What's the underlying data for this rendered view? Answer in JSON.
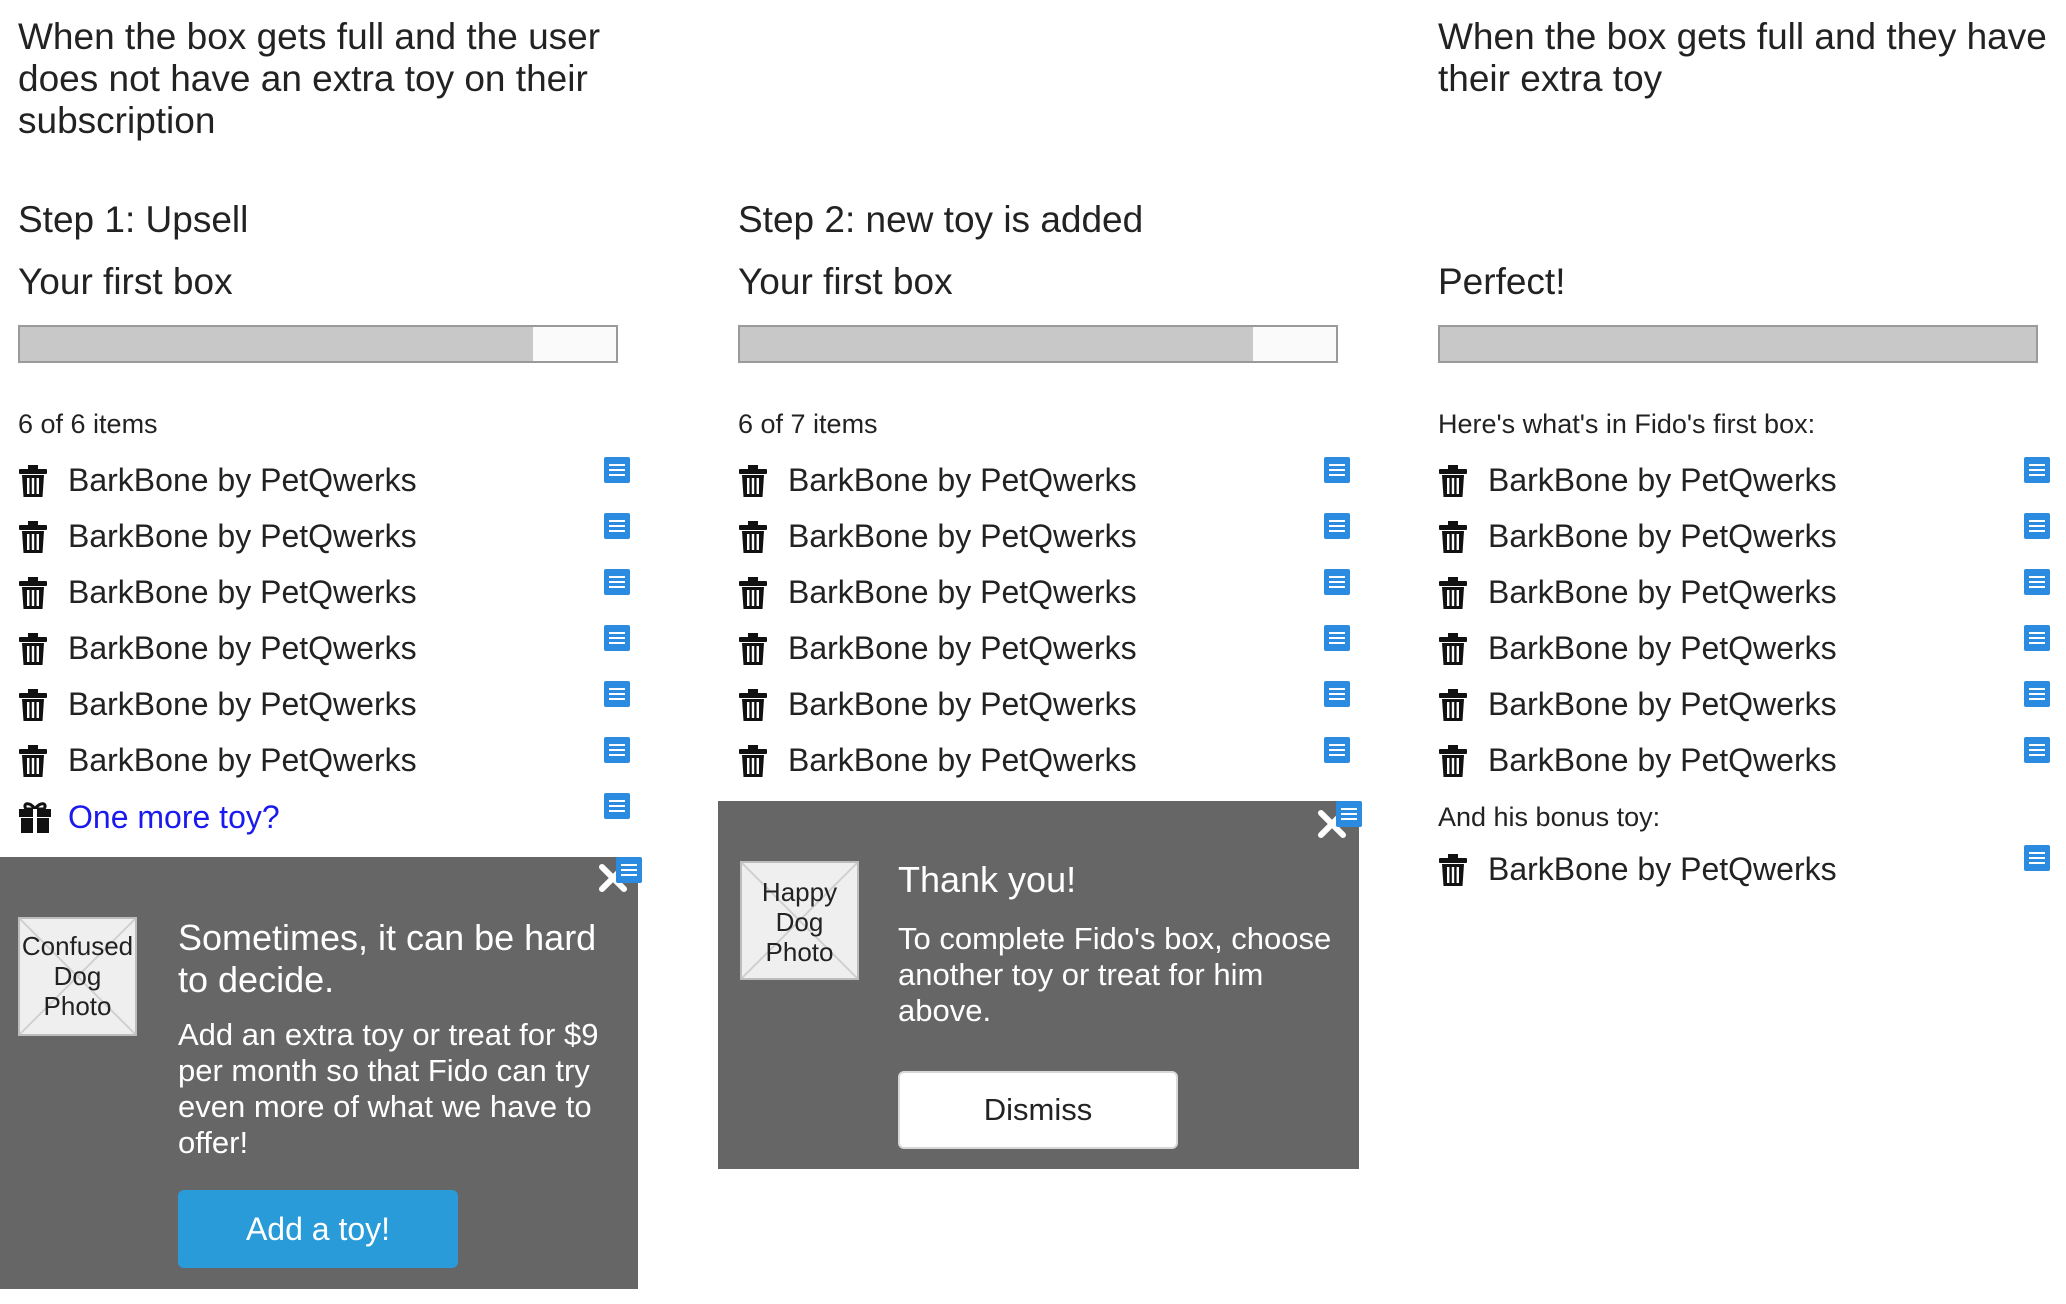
{
  "columns": [
    {
      "heading": "When the box gets full and the user does not have an extra toy on their subscription",
      "step": "Step 1: Upsell",
      "box_title": "Your first box",
      "progress": 0.86,
      "count": "6 of 6 items",
      "items": [
        "BarkBone by PetQwerks",
        "BarkBone by PetQwerks",
        "BarkBone by PetQwerks",
        "BarkBone by PetQwerks",
        "BarkBone by PetQwerks",
        "BarkBone by PetQwerks"
      ],
      "extra_link": "One more toy?",
      "popup": {
        "photo": [
          "Confused",
          "Dog",
          "Photo"
        ],
        "title": "Sometimes, it can be hard to decide.",
        "body": "Add an extra toy or treat for $9 per month so that Fido can try even more of what we have to offer!",
        "button": "Add a toy!"
      }
    },
    {
      "step": "Step 2: new toy is added",
      "box_title": "Your first box",
      "progress": 0.86,
      "count": "6 of 7 items",
      "items": [
        "BarkBone by PetQwerks",
        "BarkBone by PetQwerks",
        "BarkBone by PetQwerks",
        "BarkBone by PetQwerks",
        "BarkBone by PetQwerks",
        "BarkBone by PetQwerks"
      ],
      "popup": {
        "photo": [
          "Happy",
          "Dog",
          "Photo"
        ],
        "title": "Thank you!",
        "body": "To complete Fido's box, choose another toy or treat for him above.",
        "button": "Dismiss"
      }
    },
    {
      "heading": "When the box gets full and they have their extra toy",
      "box_title": "Perfect!",
      "progress": 1.0,
      "intro": "Here's what's in Fido's first box:",
      "items": [
        "BarkBone by PetQwerks",
        "BarkBone by PetQwerks",
        "BarkBone by PetQwerks",
        "BarkBone by PetQwerks",
        "BarkBone by PetQwerks",
        "BarkBone by PetQwerks"
      ],
      "bonus_label": "And his bonus toy:",
      "bonus_item": "BarkBone by PetQwerks"
    }
  ],
  "colors": {
    "panel": "#666666",
    "accent_button": "#2a9bd9",
    "note_icon": "#2a8be0",
    "link": "#1a1aee",
    "bar_fill": "#c8c8c8"
  },
  "icons": {
    "item": "trash-icon",
    "extra": "gift-icon",
    "note": "note-icon",
    "close": "close-icon"
  }
}
